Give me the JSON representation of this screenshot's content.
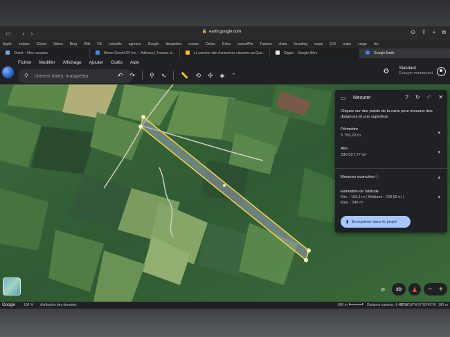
{
  "safari": {
    "url": "earth.google.com"
  },
  "favorites": [
    "Apple",
    "mobiss",
    "iCloud",
    "Yahoo",
    "Bing",
    "Wiki",
    "FB",
    "LinkedIn",
    "agresse",
    "Google",
    "desjardins",
    "messe",
    "Dertur",
    "Exlus",
    "sonnelPm",
    "Futures",
    "chats",
    "linvading",
    "equis",
    "JLR",
    "maps",
    "cargo",
    "clic"
  ],
  "tabs": [
    {
      "label": "Orient – Mes comptes",
      "color": "#6fa8dc"
    },
    {
      "label": "Meteo Ouvrid OF Inc. – Adénors | Travaux d...",
      "color": "#4a86e8"
    },
    {
      "label": "Le premier site d'annonces classées au Qué...",
      "color": "#f1c232"
    },
    {
      "label": "Digale – Google Alfos",
      "color": "#e6e6e6"
    },
    {
      "label": "Google Earth",
      "color": "#4285f4"
    }
  ],
  "earth": {
    "menu": [
      "Fichier",
      "Modifier",
      "Affichage",
      "Ajouter",
      "Outils",
      "Aide"
    ],
    "search_value": "chemin haley, matapédia",
    "plan_name": "Standard",
    "plan_action": "Essayer maintenant"
  },
  "measure_panel": {
    "title": "Mesurer",
    "instructions": "Cliquez sur des points de la carte pour mesurer des distances et une superficie",
    "perimeter_label": "Périmètre",
    "perimeter_value": "5 756,22 m",
    "area_label": "Aire",
    "area_value": "330 027,77 m²",
    "advanced_label": "Mesures avancées",
    "altitude_label": "Estimation de l'altitude",
    "altitude_line1": "Min. : 163,1 m | Médiane : 228,65 m |",
    "altitude_line2": "Max. : 246 m",
    "save_label": "Enregistrer dans le projet"
  },
  "map_controls": {
    "three_d_label": "3D"
  },
  "status": {
    "brand": "Google",
    "zoom": "100 %",
    "attribution": "Attribution des données",
    "scale": "800 m",
    "camera": "Distance caméra : 5 451 m",
    "coords": "47°37'16\"N 67°03'43\"W",
    "elevation": "165 m"
  },
  "colors": {
    "measure_line": "#f5d547",
    "panel_bg": "#202124",
    "button_bg": "#a8c7fa",
    "compass_red": "#ea4335"
  },
  "icons": {
    "search": "search-icon",
    "settings": "gear-icon",
    "help": "help-icon",
    "close": "close-icon"
  }
}
